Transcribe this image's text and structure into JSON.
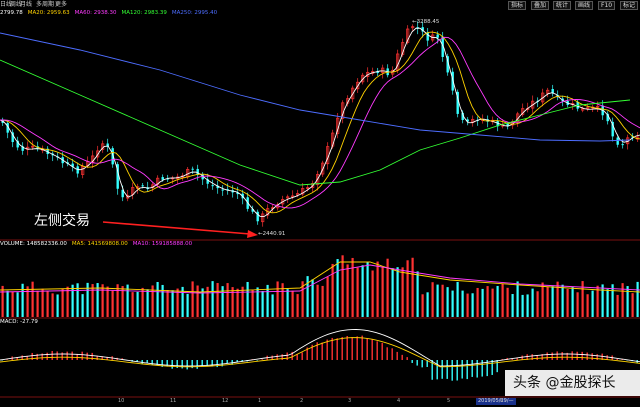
{
  "toolbar": {
    "tabs": [
      "日线",
      "周线",
      "月线",
      "多周期",
      "更多"
    ],
    "right_buttons": [
      "指标",
      "叠加",
      "统计",
      "画线",
      "F10",
      "标记"
    ],
    "window_buttons": [
      "□",
      "✕"
    ]
  },
  "main_legend": {
    "items": [
      {
        "text": "2799.78",
        "color": "#ffffff"
      },
      {
        "text": "MA20: 2959.63",
        "color": "#ffd200"
      },
      {
        "text": "MA60: 2938.30",
        "color": "#ff3bff"
      },
      {
        "text": "MA120: 2983.39",
        "color": "#33ff33"
      },
      {
        "text": "MA250: 2995.40",
        "color": "#4d6dff"
      }
    ]
  },
  "annotation": {
    "text": "左侧交易",
    "color": "#ffffff",
    "arrow_color": "#ff2020"
  },
  "price_labels": {
    "high": "3288.45",
    "low": "2440.91"
  },
  "volume_legend": {
    "items": [
      {
        "text": "VOLUME: 148582336.00",
        "color": "#ffffff"
      },
      {
        "text": "MA5: 141569808.00",
        "color": "#ffd200"
      },
      {
        "text": "MA10: 159185888.00",
        "color": "#ff3bff"
      }
    ]
  },
  "macd_legend": {
    "text": "MACD: -27.79",
    "color": "#ffffff"
  },
  "bottom_date": "2019/05/29/—",
  "x_ticks": [
    "10",
    "11",
    "12",
    "1",
    "2",
    "3",
    "4",
    "5",
    "6"
  ],
  "watermark": "头条 @金股探长",
  "colors": {
    "up": "#ff3232",
    "down": "#33ffff",
    "ma5": "#ffffff",
    "ma20": "#ffd200",
    "ma60": "#ff3bff",
    "ma120": "#33ff33",
    "ma250": "#4d6dff"
  }
}
